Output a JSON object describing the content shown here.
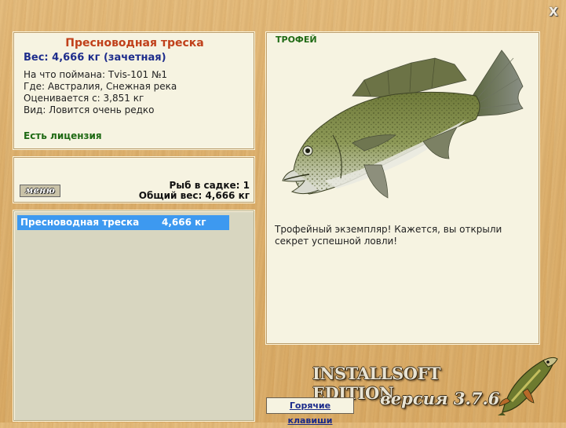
{
  "window": {
    "close_label": "X"
  },
  "info": {
    "fish_name": "Пресноводная треска",
    "weight_line": "Вес: 4,666 кг (зачетная)",
    "rows": [
      "На что поймана: Tvis-101 №1",
      "Где: Австралия, Снежная река",
      "Оценивается с: 3,851 кг",
      "Вид: Ловится очень редко"
    ],
    "license": "Есть лицензия"
  },
  "keepnet": {
    "menu_label": "меню",
    "count_line": "Рыб в садке: 1",
    "total_line": "Общий вес: 4,666 кг"
  },
  "list": {
    "items": [
      {
        "name": "Пресноводная треска",
        "weight": "4,666 кг",
        "selected": true
      }
    ]
  },
  "trophy": {
    "title": "ТРОФЕЙ",
    "text": "Трофейный экземпляр! Кажется, вы открыли секрет успешной ловли!",
    "fish_icon": "murray-cod-icon"
  },
  "branding": {
    "edition": "INSTALLSOFT EDITION",
    "version": "версия 3.7.6",
    "logo_icon": "pike-icon"
  },
  "hotkeys": {
    "label": "Горячие клавиши"
  },
  "colors": {
    "highlight": "#3d99f0",
    "fish_name": "#c0401a",
    "weight": "#1e2d8c",
    "license": "#1f6a14"
  }
}
